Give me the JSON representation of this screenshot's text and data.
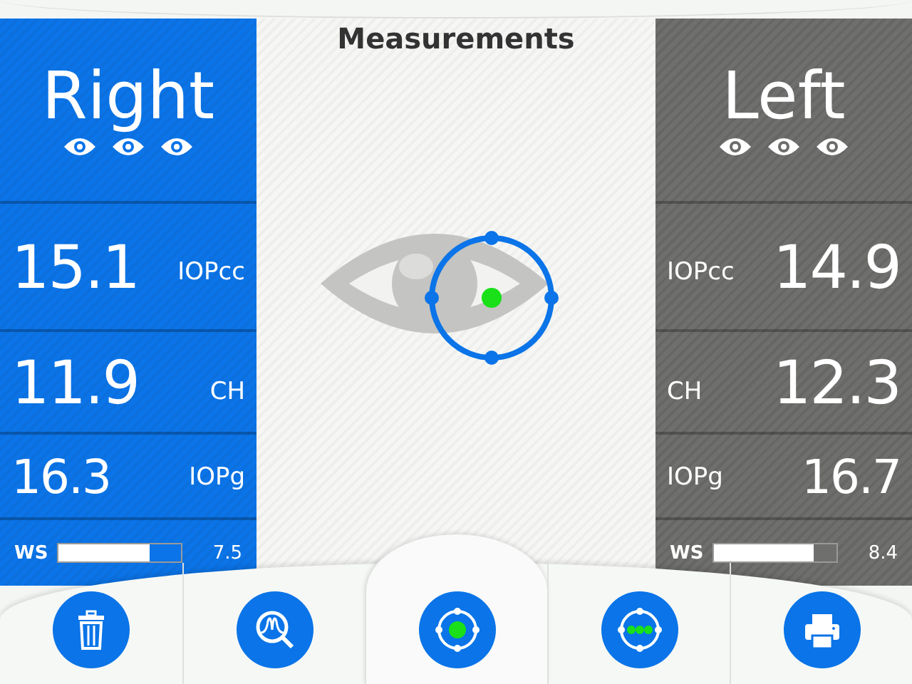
{
  "title": "Measurements",
  "panels": [
    {
      "kind": "value-first",
      "selected": true,
      "heading": "Right",
      "metrics": [
        {
          "value": "15.1",
          "label": "IOPcc"
        },
        {
          "value": "11.9",
          "label": "CH"
        },
        {
          "value": "16.3",
          "label": "IOPg"
        }
      ],
      "ws": {
        "label": "WS",
        "level": 0.75,
        "reading": "7.5"
      }
    },
    {
      "kind": "label-first",
      "selected": false,
      "heading": "Left",
      "metrics": [
        {
          "value": "14.9",
          "label": "IOPcc"
        },
        {
          "value": "12.3",
          "label": "CH"
        },
        {
          "value": "16.7",
          "label": "IOPg"
        }
      ],
      "ws": {
        "label": "WS",
        "level": 0.82,
        "reading": "8.4"
      }
    }
  ],
  "toolbar": [
    {
      "kind": "trash",
      "selected": false
    },
    {
      "kind": "waveform",
      "selected": false
    },
    {
      "kind": "target",
      "selected": true
    },
    {
      "kind": "dots",
      "selected": false
    },
    {
      "kind": "printer",
      "selected": false
    }
  ]
}
